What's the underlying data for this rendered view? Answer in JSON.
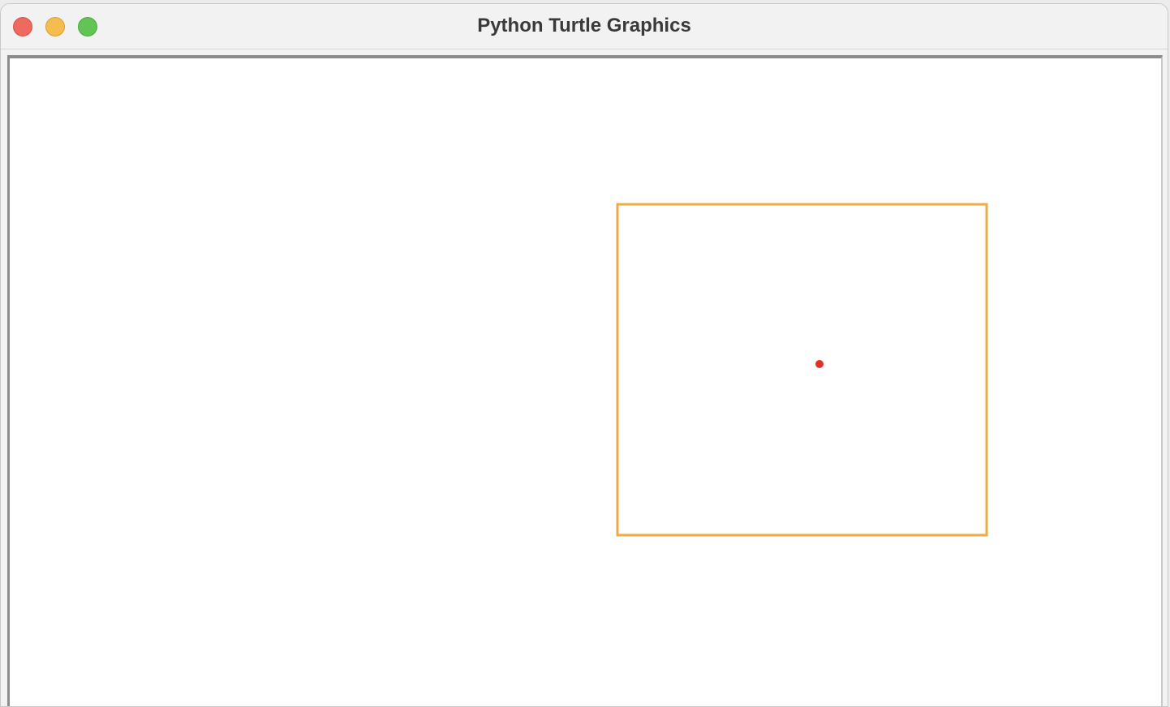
{
  "window": {
    "title": "Python Turtle Graphics"
  },
  "traffic_lights": {
    "close_color": "#ee6a5e",
    "minimize_color": "#f5bd4f",
    "maximize_color": "#61c454"
  },
  "drawing": {
    "square_stroke_color": "#eeaa44",
    "dot_color": "#e0302a"
  }
}
